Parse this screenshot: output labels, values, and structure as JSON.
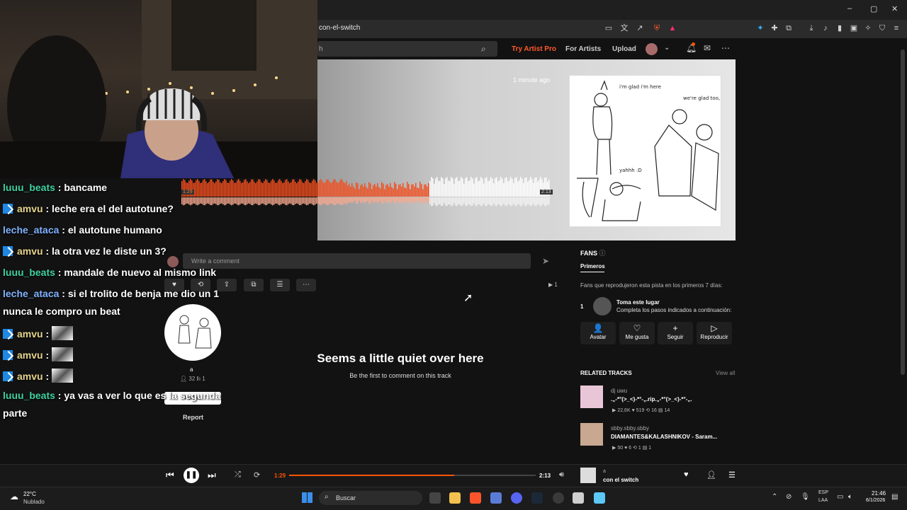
{
  "browser": {
    "url": "con-el-switch",
    "window_controls": [
      "–",
      "▢",
      "✕"
    ]
  },
  "soundcloud": {
    "search_placeholder": "h",
    "nav": {
      "try_pro": "Try Artist Pro",
      "for_artists": "For Artists",
      "upload": "Upload"
    },
    "hero": {
      "time_ago": "1 minute ago",
      "artwork_text": {
        "a": "i'm glad i'm here",
        "b": "we're glad too, girl :3",
        "c": "yahhh :D"
      },
      "wave_current": "1:29",
      "wave_total": "2:13",
      "progress_fraction": 0.67
    },
    "comment": {
      "placeholder": "Write a comment",
      "plays": "1"
    },
    "uploader": {
      "name": "a",
      "followers": "32",
      "tracks": "1",
      "follow_label": "Follow",
      "report": "Report"
    },
    "empty_state": {
      "title": "Seems a little quiet over here",
      "subtitle": "Be the first to comment on this track"
    },
    "fans": {
      "title": "FANS",
      "tab": "Primeros",
      "description": "Fans que reprodujeron esta pista en los primeros 7 días:",
      "rank": "1",
      "cta_title": "Toma este lugar",
      "cta_sub": "Completa los pasos indicados a continuación:",
      "actions": [
        {
          "label": "Avatar",
          "icon": "👤"
        },
        {
          "label": "Me gusta",
          "icon": "♡"
        },
        {
          "label": "Seguir",
          "icon": "+"
        },
        {
          "label": "Reproducir",
          "icon": "▷"
        }
      ]
    },
    "related": {
      "title": "RELATED TRACKS",
      "view_all": "View all",
      "tracks": [
        {
          "artist": "dj uwu",
          "title": ".„-*°(>_<)-*°-„.rip.„-*°(>_<)-*°-„.",
          "plays": "22,6K",
          "likes": "519",
          "reposts": "16",
          "comments": "14",
          "thumb": "#e8c6d8"
        },
        {
          "artist": "sbby.sbby.sbby",
          "title": "DIAMANTES&KALASHNIKOV - Saram...",
          "plays": "50",
          "likes": "6",
          "reposts": "1",
          "comments": "1",
          "thumb": "#c8a890"
        }
      ]
    },
    "player": {
      "current": "1:29",
      "total": "2:13",
      "progress_fraction": 0.67,
      "track_artist": "a",
      "track_title": "con el switch"
    }
  },
  "chat": [
    {
      "user": "luuu_beats",
      "color": "#3fd1a1",
      "badge": false,
      "msg": "bancame"
    },
    {
      "user": "amvu",
      "color": "#e6d48a",
      "badge": true,
      "msg": "leche era el del autotune?"
    },
    {
      "user": "leche_ataca",
      "color": "#7fb2ff",
      "badge": false,
      "msg": "el autotune humano"
    },
    {
      "user": "amvu",
      "color": "#e6d48a",
      "badge": true,
      "msg": "la otra vez le diste un 3?"
    },
    {
      "user": "luuu_beats",
      "color": "#3fd1a1",
      "badge": false,
      "msg": "mandale de nuevo al mismo link"
    },
    {
      "user": "leche_ataca",
      "color": "#7fb2ff",
      "badge": false,
      "msg": "si el trolito de benja me dio un 1"
    },
    {
      "continuation": "nunca le compro un beat"
    },
    {
      "user": "amvu",
      "color": "#e6d48a",
      "badge": true,
      "emote": true,
      "msg": ""
    },
    {
      "user": "amvu",
      "color": "#e6d48a",
      "badge": true,
      "emote": true,
      "msg": ""
    },
    {
      "user": "amvu",
      "color": "#e6d48a",
      "badge": true,
      "emote": true,
      "msg": ""
    },
    {
      "user": "luuu_beats",
      "color": "#3fd1a1",
      "badge": false,
      "msg": "ya vas a ver lo que es la segunda"
    },
    {
      "continuation": "parte"
    }
  ],
  "taskbar": {
    "weather_temp": "22°C",
    "weather_desc": "Nublado",
    "search_label": "Buscar",
    "lang": "ESP",
    "lang_sub": "LAA",
    "time": "21:46",
    "date": "6/1/2026"
  },
  "colors": {
    "accent": "#ff5500",
    "bg": "#121212",
    "panel": "#303030"
  }
}
